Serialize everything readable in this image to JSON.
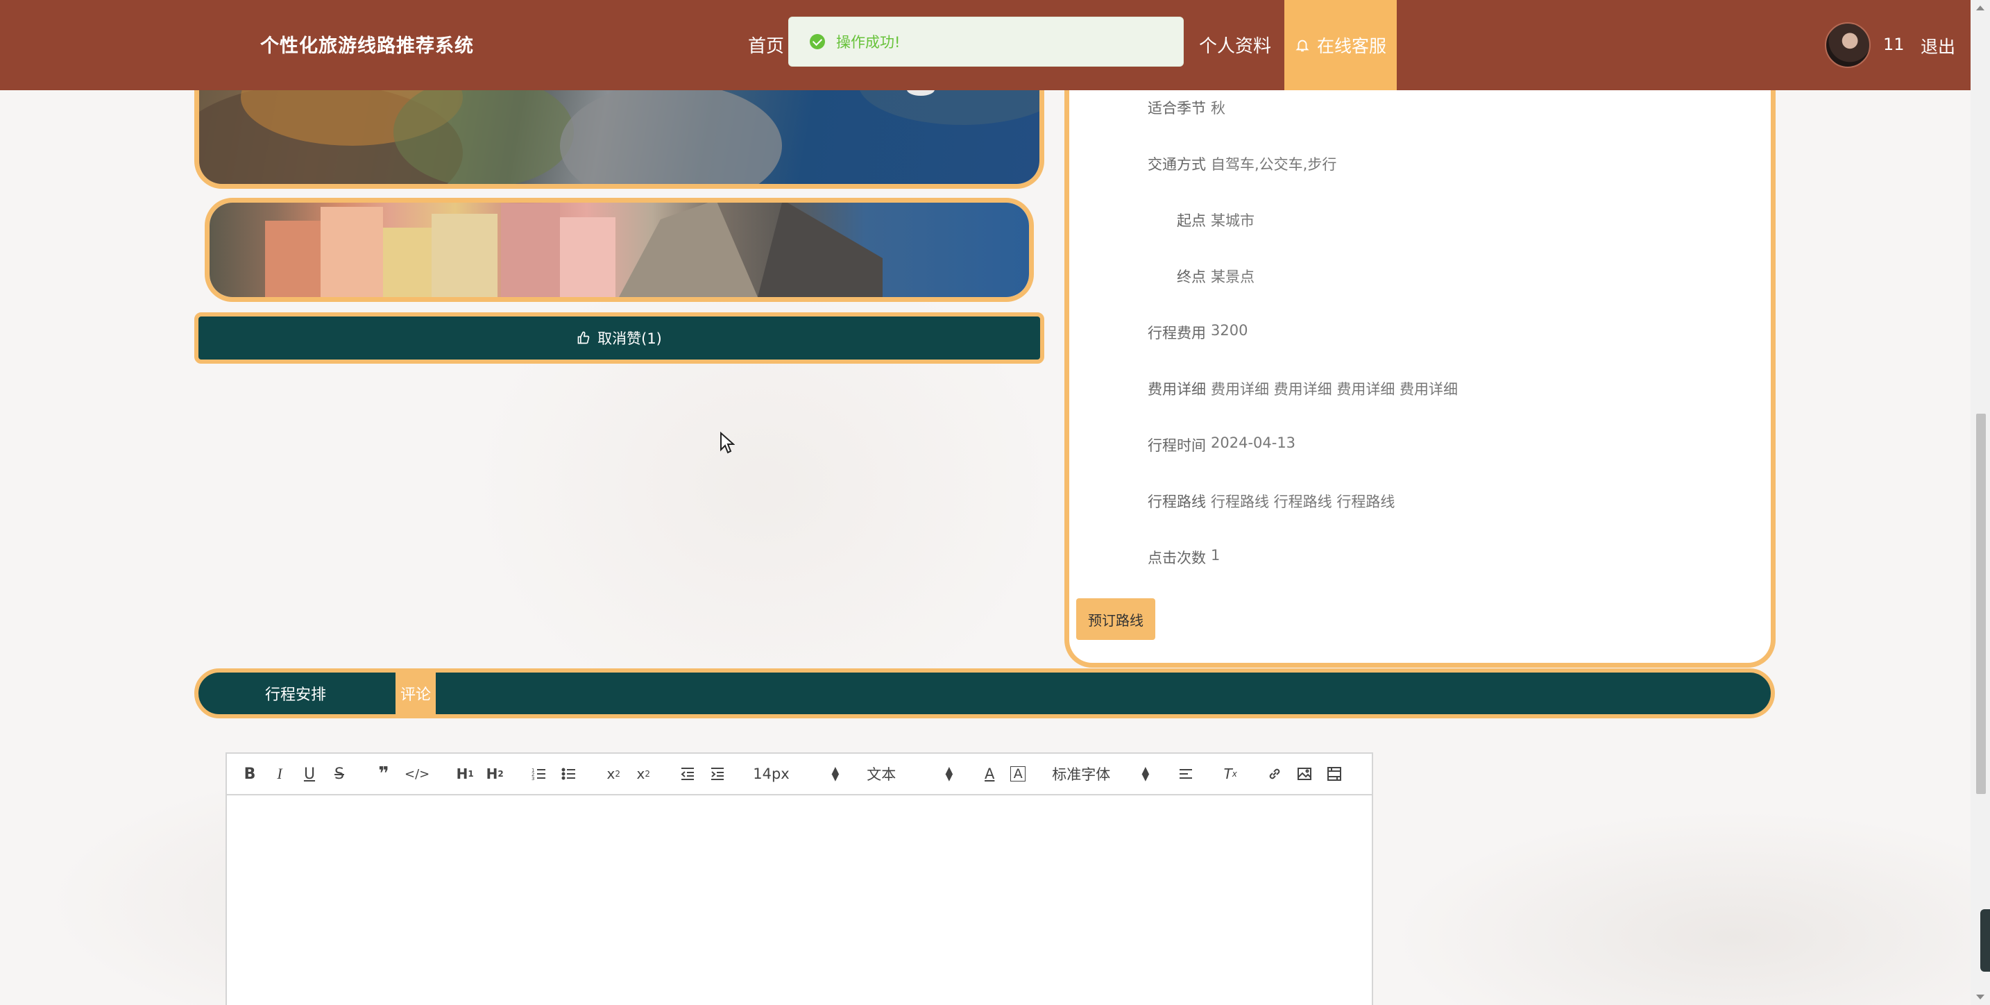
{
  "header": {
    "brand": "个性化旅游线路推荐系统",
    "nav_home": "首页",
    "nav_profile": "个人资料",
    "nav_service": "在线客服",
    "user_name": "11",
    "logout": "退出"
  },
  "toast": {
    "message": "操作成功!"
  },
  "like_button": {
    "label": "取消赞(1)"
  },
  "details": [
    {
      "label": "适合季节",
      "value": "秋"
    },
    {
      "label": "交通方式",
      "value": "自驾车,公交车,步行"
    },
    {
      "label": "起点",
      "value": "某城市"
    },
    {
      "label": "终点",
      "value": "某景点"
    },
    {
      "label": "行程费用",
      "value": "3200"
    },
    {
      "label": "费用详细",
      "value": "费用详细 费用详细 费用详细 费用详细"
    },
    {
      "label": "行程时间",
      "value": "2024-04-13"
    },
    {
      "label": "行程路线",
      "value": "行程路线 行程路线 行程路线"
    },
    {
      "label": "点击次数",
      "value": "1"
    }
  ],
  "book_button": "预订路线",
  "tabs": {
    "itinerary": "行程安排",
    "comment": "评论"
  },
  "editor": {
    "font_size": "14px",
    "text_type": "文本",
    "font_family": "标准字体"
  },
  "colors": {
    "header": "#934531",
    "accent": "#f6bc6c",
    "dark_teal": "#0f4648"
  }
}
